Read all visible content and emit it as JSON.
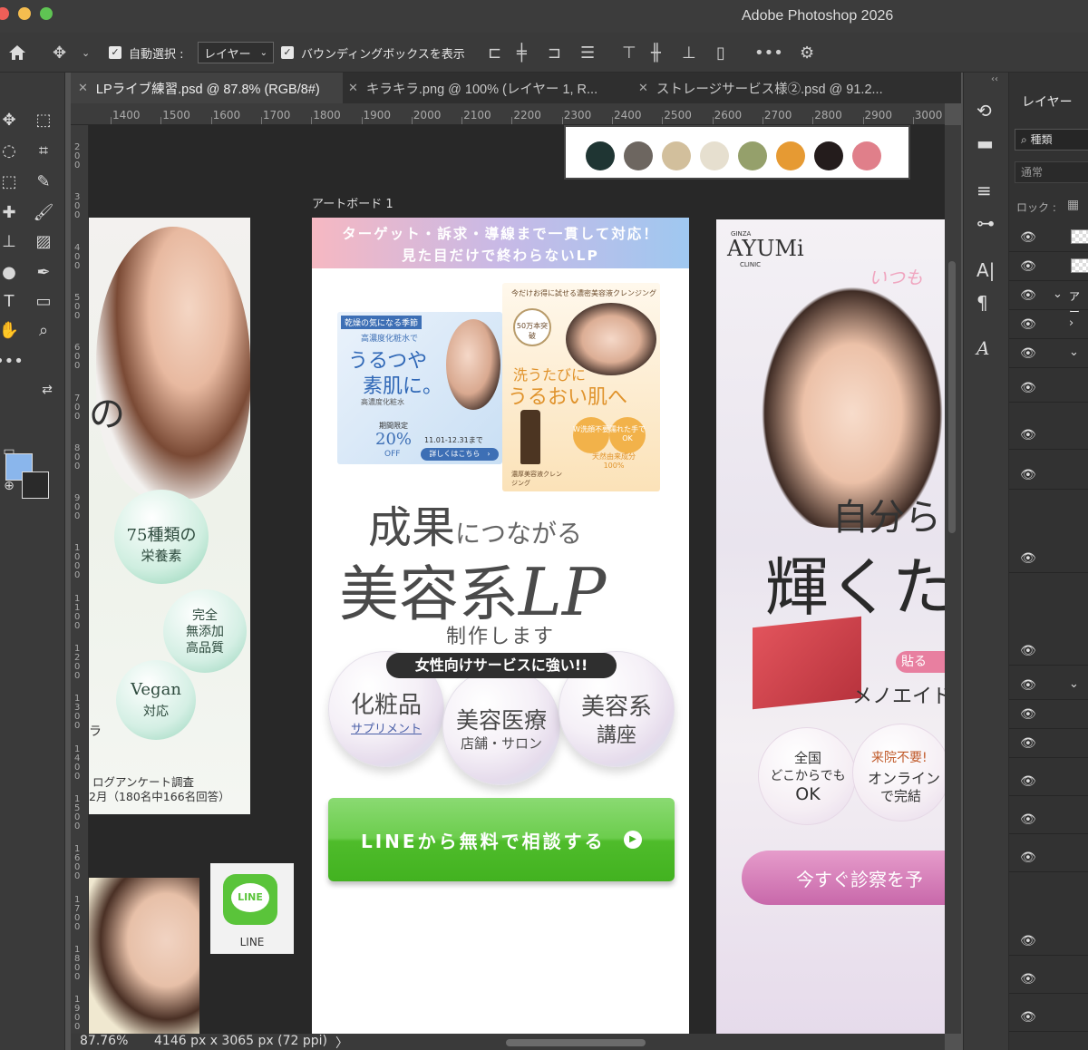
{
  "window": {
    "title": "Adobe Photoshop 2026"
  },
  "options": {
    "auto_select_label": "自動選択 :",
    "auto_select_target": "レイヤー",
    "bounding_box_label": "バウンディングボックスを表示",
    "more": "•••"
  },
  "tabs": [
    {
      "label": "LPライブ練習.psd @ 87.8% (RGB/8#)"
    },
    {
      "label": "キラキラ.png @ 100% (レイヤー 1, R..."
    },
    {
      "label": "ストレージサービス様②.psd @ 91.2..."
    }
  ],
  "ruler": {
    "top": [
      "1400",
      "1500",
      "1600",
      "1700",
      "1800",
      "1900",
      "2000",
      "2100",
      "2200",
      "2300",
      "2400",
      "2500",
      "2600",
      "2700",
      "2800",
      "2900",
      "3000"
    ],
    "left": [
      "200",
      "300",
      "400",
      "500",
      "600",
      "700",
      "800",
      "900",
      "1000",
      "1100",
      "1200",
      "1300",
      "1400",
      "1500",
      "1600",
      "1700",
      "1800",
      "1900"
    ]
  },
  "status": {
    "zoom": "87.76%",
    "doc_size": "4146 px x 3065 px (72 ppi)",
    "arrow": "〉"
  },
  "layers_panel": {
    "title": "レイヤー",
    "filter": "種類",
    "blend": "通常",
    "lock_label": "ロック :",
    "group_label": "アー"
  },
  "palette": {
    "colors": [
      "#1f3533",
      "#6d6660",
      "#d2bf9c",
      "#e6dfcf",
      "#95a06b",
      "#e69a33",
      "#241c1c",
      "#e07f8a"
    ]
  },
  "left_preview": {
    "big_char": "の",
    "badge1": "75種類の",
    "badge1b": "栄養素",
    "badge2a": "完全",
    "badge2b": "無添加",
    "badge2c": "高品質",
    "badge3a": "Vegan",
    "badge3b": "対応",
    "survey1": "ログアンケート調査",
    "survey2": "2月（180名中166名回答）",
    "side_text": "ラ"
  },
  "line_icon": {
    "logo": "LINE",
    "caption": "LINE"
  },
  "artboard": {
    "label": "アートボード 1",
    "banner_line1": "ターゲット・訴求・導線まで一貫して対応！",
    "banner_line2": "見た目だけで終わらないLP",
    "card1": {
      "tag": "乾燥の気になる季節",
      "sub": "高濃度化粧水で",
      "main1": "うるつや",
      "main2": "素肌に。",
      "product": "高濃度化粧水",
      "limited": "期間限定",
      "sale": "20%",
      "off": "OFF",
      "period": "11.01-12.31まで",
      "button": "詳しくはこちら　›"
    },
    "card2": {
      "top": "今だけお得に試せる濃密美容液クレンジング",
      "seal": "50万本突破",
      "line1": "洗うたびに",
      "line2": "うるおい肌へ",
      "b1": "W洗顔不要",
      "b2": "濡れた手でOK",
      "b3": "天然由来成分100%",
      "product": "濃厚美容液クレンジング"
    },
    "title_line1a": "成果",
    "title_line1b": "につながる",
    "title_line2a": "美容系",
    "title_line2b": "LP",
    "title_line3": "制作します",
    "pill": "女性向けサービスに強い!!",
    "bubble1a": "化粧品",
    "bubble1b": "サプリメント",
    "bubble2a": "美容医療",
    "bubble2b": "店舗・サロン",
    "bubble3a": "美容系",
    "bubble3b": "講座",
    "cta": "LINEから無料で相談する",
    "cta_icon": "▶"
  },
  "right_preview": {
    "brand_top": "GINZA",
    "brand": "AYUMi",
    "brand_bottom": "CLINIC",
    "script": "いつも",
    "h1": "自分ら",
    "h2": "輝くた",
    "tag": "貼る",
    "product": "メノエイド",
    "b1a": "全国",
    "b1b": "どこからでも",
    "b1c": "OK",
    "b2a": "来院不要!",
    "b2b": "オンライン",
    "b2c": "で完結",
    "cta": "今すぐ診察を予"
  }
}
